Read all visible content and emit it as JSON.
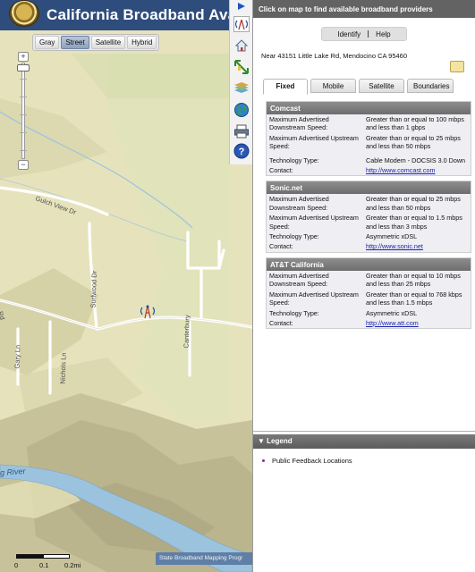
{
  "app": {
    "title": "California Broadband Availa"
  },
  "map": {
    "basemap_options": [
      {
        "label": "Gray",
        "active": false
      },
      {
        "label": "Street",
        "active": true
      },
      {
        "label": "Satellite",
        "active": false
      },
      {
        "label": "Hybrid",
        "active": false
      }
    ],
    "zoom": {
      "in_symbol": "+",
      "out_symbol": "−"
    },
    "road_labels": [
      "Gulch View Dr",
      "Surfwood Dr",
      "Rd",
      "Gary Ln",
      "Nichols Ln",
      "Canterbury"
    ],
    "river_label": "g River",
    "scale": {
      "labels": [
        "0",
        "0.1",
        "0.2mi"
      ]
    },
    "footer": "State Broadband Mapping Progr",
    "tools": [
      "arrow-icon",
      "tower-icon",
      "home-icon",
      "zoom-extent-icon",
      "layers-icon",
      "globe-icon",
      "print-icon",
      "help-icon"
    ],
    "help_glyph": "?"
  },
  "panel": {
    "header": "Click on map to find available broadband providers",
    "mode": {
      "identify": "Identify",
      "help": "Help"
    },
    "address": "Near 43151 Little Lake Rd, Mendocino CA 95460",
    "tabs": [
      {
        "label": "Fixed",
        "active": true
      },
      {
        "label": "Mobile",
        "active": false
      },
      {
        "label": "Satellite",
        "active": false
      },
      {
        "label": "Boundaries",
        "active": false
      }
    ],
    "providers": [
      {
        "name": "Comcast",
        "downstream_label": "Maximum Advertised Downstream Speed:",
        "downstream": "Greater than or equal to 100 mbps and less than 1 gbps",
        "upstream_label": "Maximum Advertised Upstream Speed:",
        "upstream": "Greater than or equal to 25 mbps and less than 50 mbps",
        "tech_label": "Technology Type:",
        "tech": "Cable Modem - DOCSIS 3.0 Down",
        "contact_label": "Contact:",
        "contact": "http://www.comcast.com"
      },
      {
        "name": "Sonic.net",
        "downstream_label": "Maximum Advertised Downstream Speed:",
        "downstream": "Greater than or equal to 25 mbps and less than 50 mbps",
        "upstream_label": "Maximum Advertised Upstream Speed:",
        "upstream": "Greater than or equal to 1.5 mbps and less than 3 mbps",
        "tech_label": "Technology Type:",
        "tech": "Asymmetric xDSL",
        "contact_label": "Contact:",
        "contact": "http://www.sonic.net"
      },
      {
        "name": "AT&T California",
        "downstream_label": "Maximum Advertised Downstream Speed:",
        "downstream": "Greater than or equal to 10 mbps and less than 25 mbps",
        "upstream_label": "Maximum Advertised Upstream Speed:",
        "upstream": "Greater than or equal to 768 kbps and less than 1.5 mbps",
        "tech_label": "Technology Type:",
        "tech": "Asymmetric xDSL",
        "contact_label": "Contact:",
        "contact": "http://www.att.com"
      }
    ],
    "legend": {
      "title": "Legend",
      "collapse_glyph": "▼",
      "items": [
        {
          "label": "Public Feedback Locations",
          "color": "#8a2f8f"
        }
      ]
    }
  },
  "colors": {
    "title_bar": "#2f4d7c",
    "panel_header": "#636363",
    "link": "#1a23b0",
    "river": "#9cc3dd"
  }
}
